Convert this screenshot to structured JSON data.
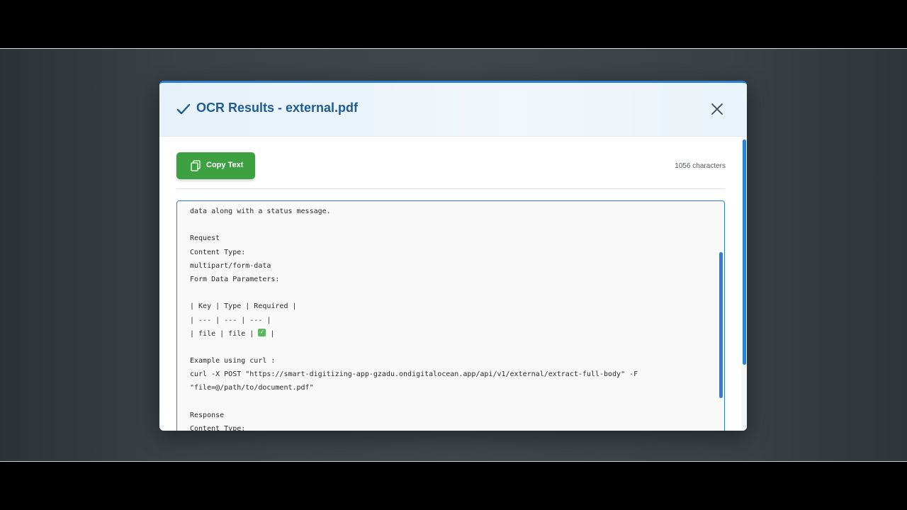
{
  "modal": {
    "title": "OCR Results - external.pdf",
    "title_icon": "check-icon",
    "close_icon": "close-icon"
  },
  "toolbar": {
    "copy_label": "Copy Text",
    "copy_icon": "copy-icon",
    "char_count": "1056 characters"
  },
  "ocr_text": {
    "lines": [
      "data along with a status message.",
      "",
      "Request",
      "Content Type:",
      "multipart/form-data",
      "Form Data Parameters:",
      "",
      "| Key | Type | Required |",
      "| --- | --- | --- |",
      "| file | file | ",
      "",
      "Example using curl :",
      "curl -X POST \"https://smart-digitizing-app-gzadu.ondigitalocean.app/api/v1/external/extract-full-body\" -F",
      "\"file=@/path/to/document.pdf\"",
      "",
      "Response",
      "Content Type:"
    ],
    "check_glyph": "✓",
    "table_end": " |"
  },
  "colors": {
    "accent": "#2b7fd4",
    "title": "#1e5c94",
    "copy_button": "#3da142"
  }
}
